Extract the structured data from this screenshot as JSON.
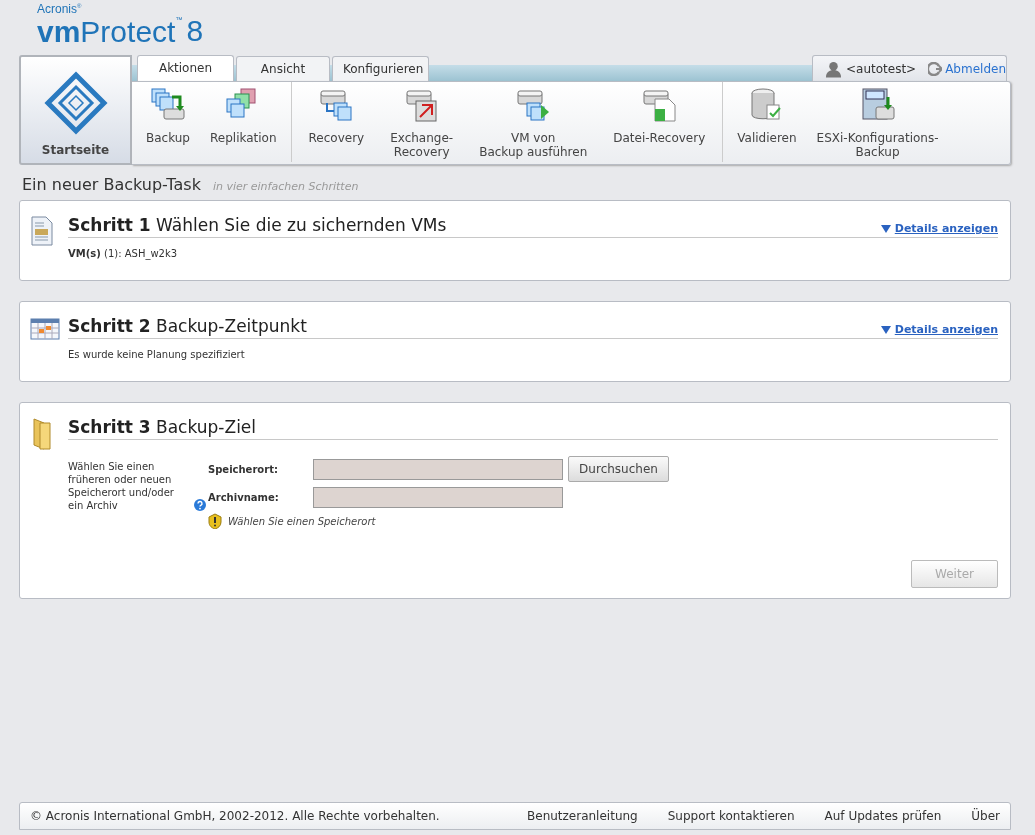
{
  "logo": {
    "vendor": "Acronis$^{®}$",
    "product": "**vm**Protect$^{™}$",
    "version": "8"
  },
  "home": {
    "label": "Startseite"
  },
  "tabs": [
    {
      "label": "Aktionen",
      "selected": true
    },
    {
      "label": "Ansicht",
      "selected": false
    },
    {
      "label": "Konfigurieren",
      "selected": false
    }
  ],
  "user": {
    "name": "<autotest>",
    "logout": "Abmelden"
  },
  "toolbar_groups": [
    {
      "items": [
        {
          "label": "Backup",
          "kind": "backup"
        },
        {
          "label": "Replikation",
          "kind": "replication"
        }
      ]
    },
    {
      "items": [
        {
          "label": "Recovery",
          "kind": "recovery"
        },
        {
          "label": "Exchange-\nRecovery",
          "kind": "exchange"
        },
        {
          "label": "VM von\nBackup ausführen",
          "kind": "runvm"
        },
        {
          "label": "Datei-Recovery",
          "kind": "file"
        }
      ]
    },
    {
      "items": [
        {
          "label": "Validieren",
          "kind": "validate"
        },
        {
          "label": "ESXi-Konfigurations-\nBackup",
          "kind": "esxi"
        }
      ]
    }
  ],
  "page_title": "Ein neuer Backup-Task",
  "page_subtitle": "in vier einfachen Schritten",
  "steps": [
    {
      "kind": "summary",
      "number": "Schritt 1",
      "title": "Wählen Sie die zu sichernden VMs",
      "details": "Details anzeigen",
      "text": "**VM(s)** (1): ASH_w2k3"
    },
    {
      "kind": "summary",
      "number": "Schritt 2",
      "title": "Backup-Zeitpunkt",
      "details": "Details anzeigen",
      "text": "Es wurde keine Planung spezifiziert"
    },
    {
      "kind": "form",
      "number": "Schritt 3",
      "title": "Backup-Ziel",
      "description": "Wählen Sie einen früheren oder neuen Speicherort und/oder ein Archiv",
      "fields": [
        {
          "label": "Speicherort:",
          "button": "Durchsuchen"
        },
        {
          "label": "Archivname:"
        }
      ],
      "warning": "Wählen Sie einen Speicherort",
      "next": {
        "label": "Weiter",
        "disabled": true
      }
    }
  ],
  "footer": {
    "copyright": "© Acronis International GmbH, 2002-2012. Alle Rechte vorbehalten.",
    "links": [
      "Benutzeranleitung",
      "Support kontaktieren",
      "Auf Updates prüfen",
      "Über"
    ]
  }
}
